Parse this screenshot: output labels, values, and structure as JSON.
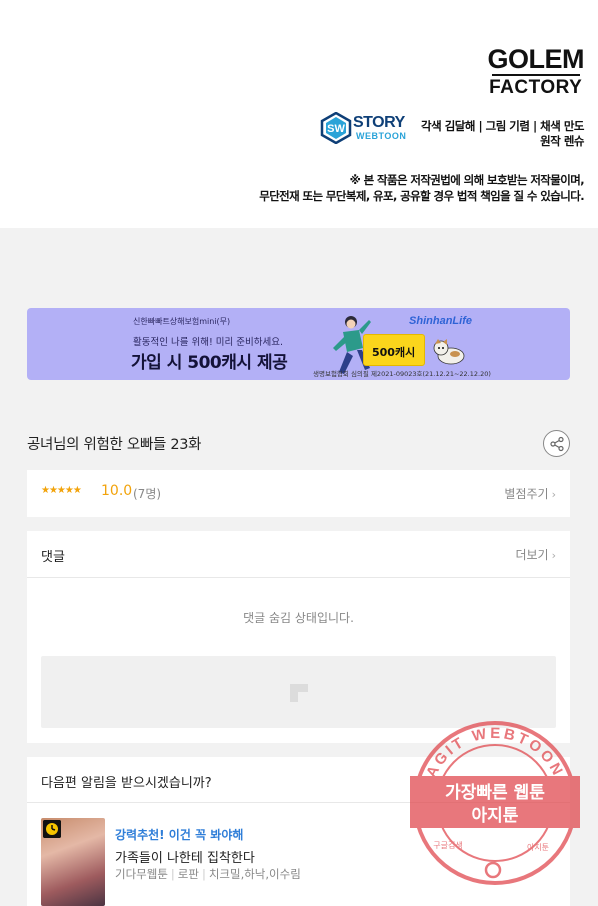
{
  "credits": {
    "studio_logo_line1": "GOLEM",
    "studio_logo_line2": "FACTORY",
    "publisher_logo_line1": "STORY",
    "publisher_logo_line2": "WEBTOON",
    "publisher_logo_badge": "SW",
    "staff_line1": "각색 김달해 | 그림 기렴 | 채색 만도",
    "staff_line2": "원작 렌슈",
    "notice_line1": "※ 본 작품은 저작권법에 의해 보호받는 저작물이며,",
    "notice_line2": "무단전재 또는 무단복제, 유포, 공유할 경우 법적 책임을 질 수 있습니다."
  },
  "ad": {
    "small_text": "신한빠빠트상해보험mini(무)",
    "sub_text": "활동적인 나를 위해! 미리 준비하세요.",
    "main_text": "가입 시 500캐시 제공",
    "brand": "ShinhanLife",
    "cash_badge": "500캐시",
    "fine_print": "생명보험협회 심의필 제2021-09023호(21.12.21~22.12.20)",
    "bg_color": "#b3b0f6"
  },
  "episode": {
    "title": "공녀님의 위험한 오빠들 23화",
    "share_icon": "share-icon"
  },
  "rating": {
    "stars": "★★★★★",
    "score": "10.0",
    "count": "(7명)",
    "rate_link": "별점주기",
    "star_color": "#f2a30b"
  },
  "comments": {
    "header": "댓글",
    "more_link": "더보기",
    "hidden_message": "댓글 숨김 상태입니다."
  },
  "next_episode": {
    "question": "다음편 알림을 받으시겠습니까?",
    "rec_label": "강력추천! 이건 꼭 봐야해",
    "rec_title": "가족들이 나한테 집착한다",
    "rec_platform": "기다무웹툰",
    "rec_genre": "로판",
    "rec_authors": "치크밀,하낙,이수림",
    "accent_color": "#2f7ed8"
  },
  "watermark": {
    "ring_text": "AGIT WEBTOON",
    "line1": "가장빠른 웹툰",
    "line2": "아지툰",
    "bottom_left": "구글검색",
    "bottom_right": "아지툰",
    "color": "#e0444a"
  }
}
